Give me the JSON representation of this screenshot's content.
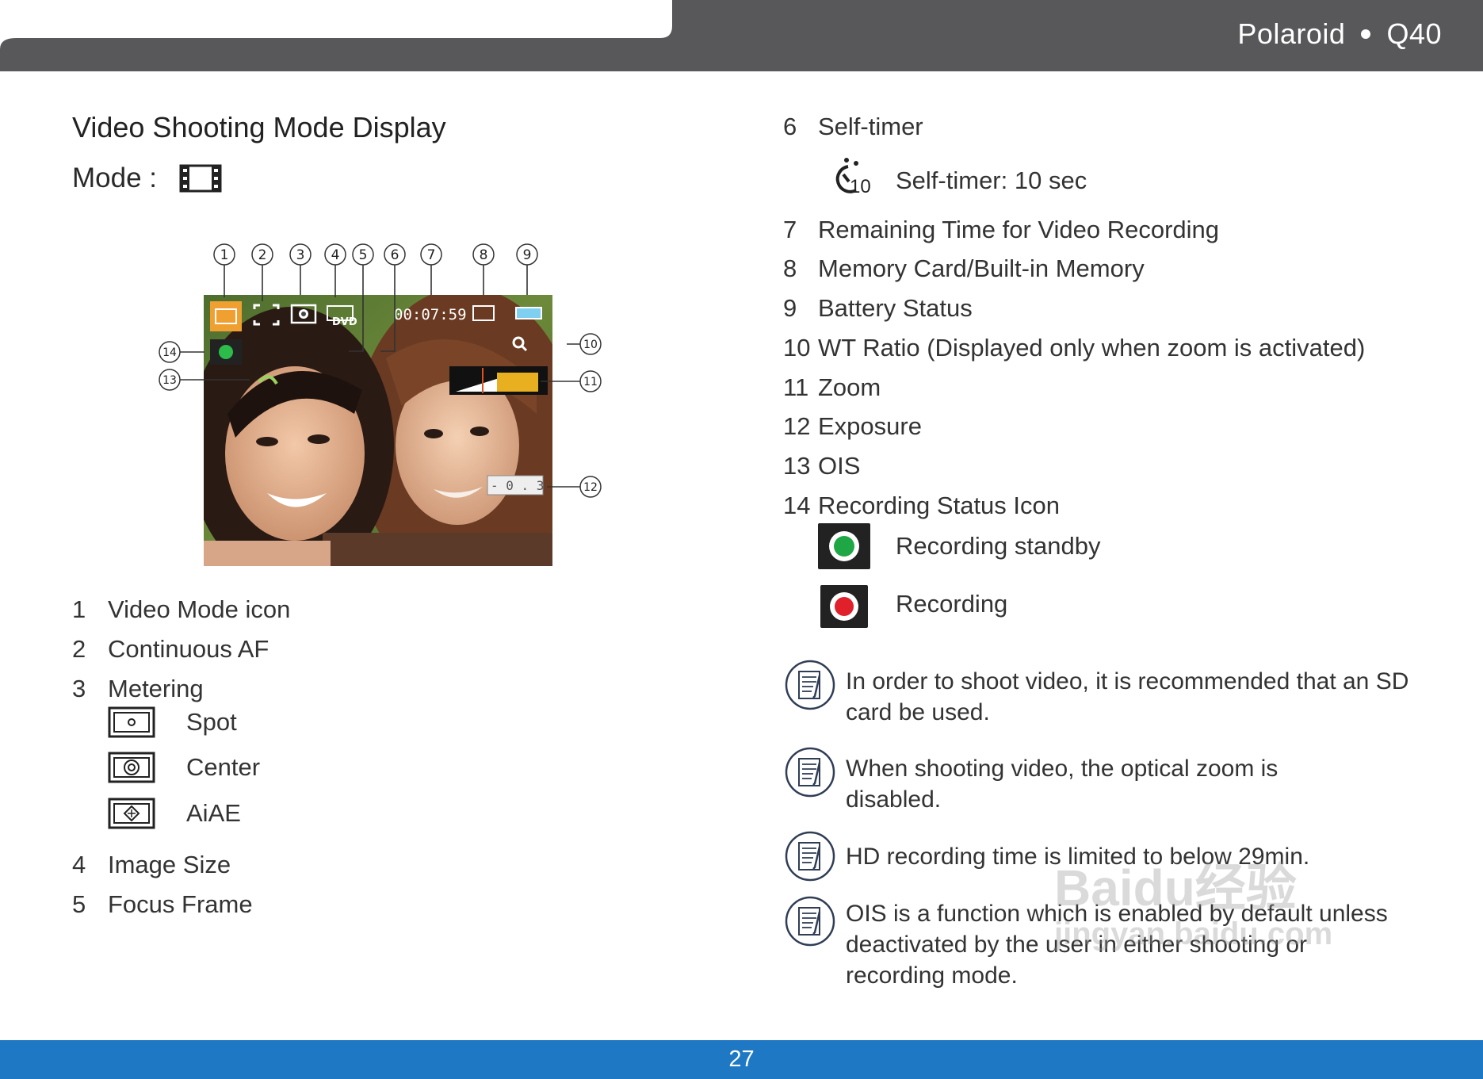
{
  "header": {
    "brand": "Polaroid",
    "model": "Q40"
  },
  "title": "Video Shooting Mode Display",
  "mode_label": "Mode :",
  "screen_overlay": {
    "time": "00:07:59",
    "ev": "- 0 . 3",
    "format": "DVD"
  },
  "callouts": [
    "1",
    "2",
    "3",
    "4",
    "5",
    "6",
    "7",
    "8",
    "9",
    "10",
    "11",
    "12",
    "13",
    "14"
  ],
  "left_list": [
    {
      "num": "1",
      "label": "Video Mode icon"
    },
    {
      "num": "2",
      "label": "Continuous AF"
    },
    {
      "num": "3",
      "label": "Metering"
    },
    {
      "num": "4",
      "label": "Image Size"
    },
    {
      "num": "5",
      "label": "Focus Frame"
    }
  ],
  "metering_options": [
    {
      "label": "Spot",
      "icon": "spot-metering-icon"
    },
    {
      "label": "Center",
      "icon": "center-metering-icon"
    },
    {
      "label": "AiAE",
      "icon": "aiae-metering-icon"
    }
  ],
  "right_list": [
    {
      "num": "6",
      "label": "Self-timer"
    },
    {
      "num": "7",
      "label": "Remaining Time for Video Recording"
    },
    {
      "num": "8",
      "label": "Memory Card/Built-in Memory"
    },
    {
      "num": "9",
      "label": "Battery Status"
    },
    {
      "num": "10",
      "label": "WT Ratio (Displayed only when zoom is activated)"
    },
    {
      "num": "11",
      "label": " Zoom"
    },
    {
      "num": "12",
      "label": "Exposure"
    },
    {
      "num": "13",
      "label": "OIS"
    },
    {
      "num": "14",
      "label": "Recording Status Icon"
    }
  ],
  "self_timer": {
    "icon_text": "10",
    "label": "Self-timer: 10 sec"
  },
  "recording_status": [
    {
      "label": "Recording standby",
      "color": "#1fa745"
    },
    {
      "label": "Recording",
      "color": "#e0202a"
    }
  ],
  "notes": [
    "In order to shoot video, it is recommended that an SD card be used.",
    "When shooting video, the optical zoom is disabled.",
    "HD recording time is limited to below 29min.",
    "OIS is a function which is enabled by default unless deactivated by the user in either shooting or recording mode."
  ],
  "watermark": {
    "line1": "Baidu经验",
    "line2": "jingyan.baidu.com"
  },
  "page_number": "27",
  "colors": {
    "header": "#58585a",
    "footer": "#1f78c3",
    "video_icon": "#f0a030",
    "zoom_bar": "#e8b020"
  }
}
